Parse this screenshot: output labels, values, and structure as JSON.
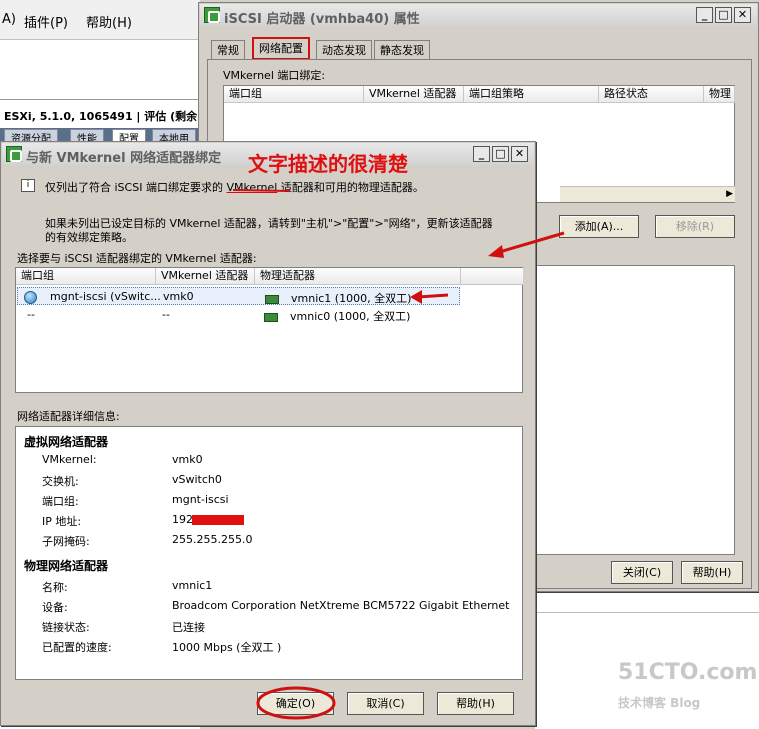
{
  "background": {
    "menu": [
      "A) 帮助(H)",
      "插件(P)",
      "帮助(H)"
    ],
    "menu_items": [
      "A)",
      "插件(P)",
      "帮助(H)"
    ],
    "host_title": "ESXi, 5.1.0, 1065491 | 评估 (剩余",
    "tabs": [
      "资源分配",
      "性能",
      "配置",
      "本地用"
    ]
  },
  "iscsi_window": {
    "title": "iSCSI 启动器 (vmhba40) 属性",
    "tabs": [
      "常规",
      "网络配置",
      "动态发现",
      "静态发现"
    ],
    "section_label": "VMkernel 端口绑定:",
    "columns": [
      "端口组",
      "VMkernel 适配器",
      "端口组策略",
      "路径状态",
      "物理"
    ],
    "add_button": "添加(A)...",
    "remove_button": "移除(R)",
    "close_button": "关闭(C)",
    "help_button": "帮助(H)"
  },
  "bind_dialog": {
    "title": "与新 VMkernel 网络适配器绑定",
    "info_text_pre": "仅列出了符合 iSCSI 端口绑定要求的 ",
    "info_text_link": "VMkernel",
    "info_text_post": " 适配器和可用的物理适配器。",
    "note_line1": "如果未列出已设定目标的 VMkernel 适配器，请转到\"主机\">\"配置\">\"网络\"，更新该适配器",
    "note_line2": "的有效绑定策略。",
    "select_label": "选择要与 iSCSI 适配器绑定的 VMkernel 适配器:",
    "columns": [
      "端口组",
      "VMkernel 适配器",
      "物理适配器"
    ],
    "rows": [
      {
        "port_group": "mgnt-iscsi (vSwitc...",
        "vmkernel": "vmk0",
        "physical": "vmnic1 (1000, 全双工)"
      },
      {
        "port_group": "--",
        "vmkernel": "--",
        "physical": "vmnic0 (1000, 全双工)"
      }
    ],
    "details_label": "网络适配器详细信息:",
    "virtual_section": "虚拟网络适配器",
    "virtual_fields": [
      {
        "label": "VMkernel:",
        "value": "vmk0"
      },
      {
        "label": "交换机:",
        "value": "vSwitch0"
      },
      {
        "label": "端口组:",
        "value": "mgnt-iscsi"
      },
      {
        "label": "IP 地址:",
        "value": "192."
      },
      {
        "label": "子网掩码:",
        "value": "255.255.255.0"
      }
    ],
    "physical_section": "物理网络适配器",
    "physical_fields": [
      {
        "label": "名称:",
        "value": "vmnic1"
      },
      {
        "label": "设备:",
        "value": "Broadcom Corporation NetXtreme BCM5722 Gigabit Ethernet"
      },
      {
        "label": "链接状态:",
        "value": "已连接"
      },
      {
        "label": "已配置的速度:",
        "value": "1000 Mbps (全双工 )"
      }
    ],
    "ok_button": "确定(O)",
    "cancel_button": "取消(C)",
    "help_button": "帮助(H)"
  },
  "annotation": {
    "text": "文字描述的很清楚",
    "color": "#e01010"
  },
  "watermark": {
    "line1": "51CTO.com",
    "line2": "技术博客 Blog"
  }
}
